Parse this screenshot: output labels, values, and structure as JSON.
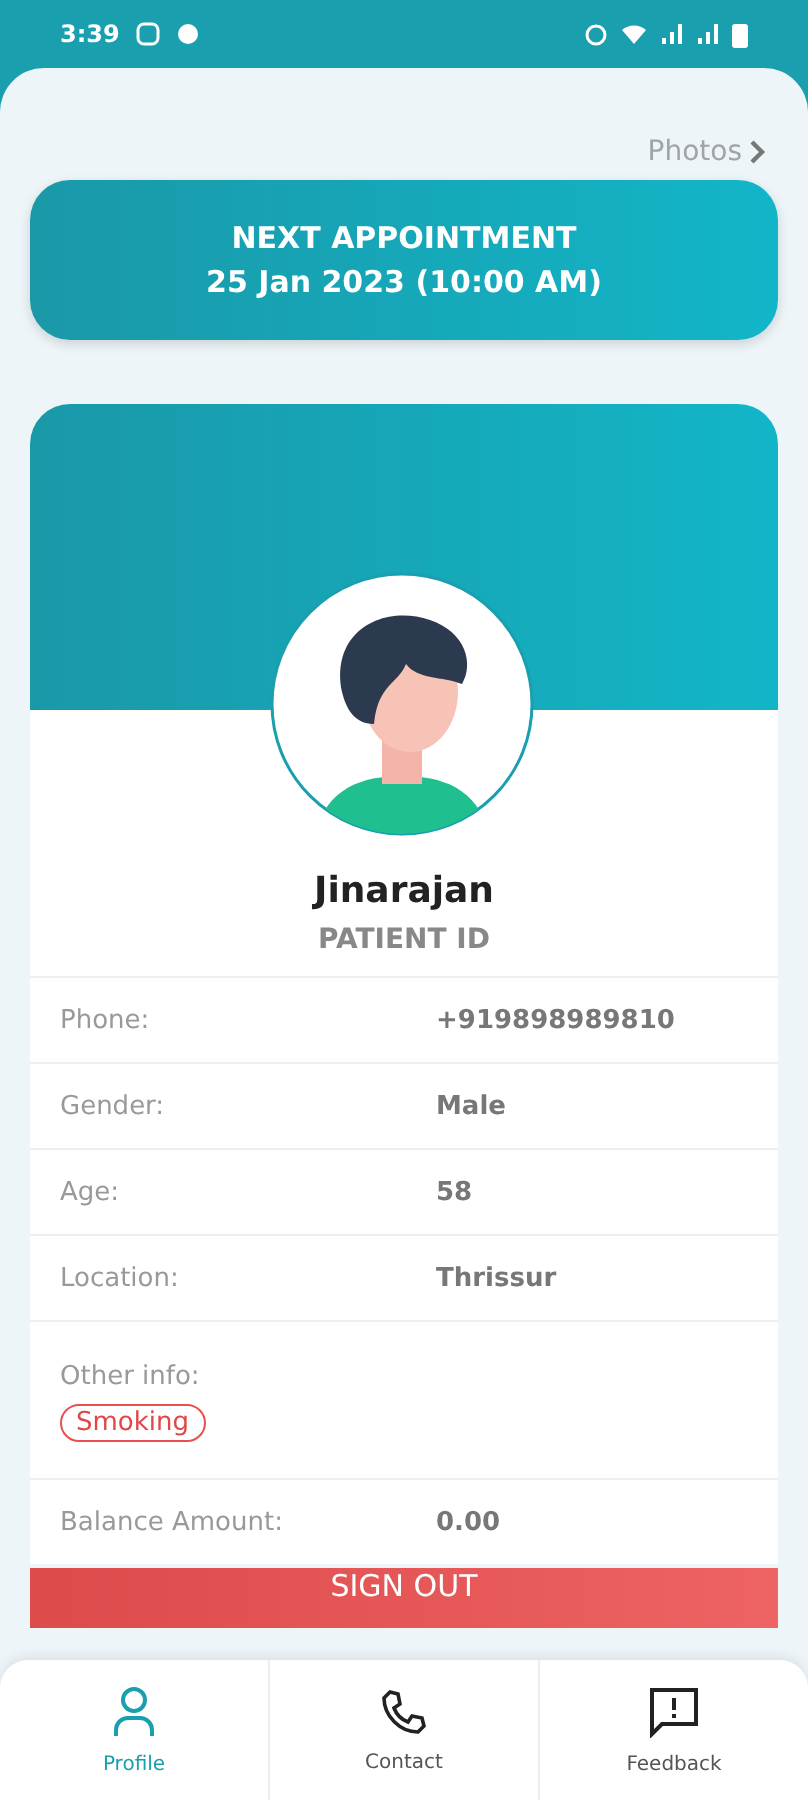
{
  "status_bar": {
    "time": "3:39"
  },
  "photos_link": {
    "label": "Photos"
  },
  "appointment": {
    "title": "NEXT APPOINTMENT",
    "when": "25 Jan 2023 (10:00 AM)"
  },
  "profile": {
    "name": "Jinarajan",
    "patient_id": "PATIENT ID"
  },
  "details": [
    {
      "kind": "text",
      "label": "Phone:",
      "value": "+919898989810"
    },
    {
      "kind": "text",
      "label": "Gender:",
      "value": "Male"
    },
    {
      "kind": "text",
      "label": "Age:",
      "value": "58"
    },
    {
      "kind": "text",
      "label": "Location:",
      "value": "Thrissur"
    },
    {
      "kind": "tags",
      "label": "Other info:",
      "tags": [
        "Smoking"
      ]
    },
    {
      "kind": "text",
      "label": "Balance Amount:",
      "value": "0.00"
    }
  ],
  "sign_out": {
    "label": "SIGN OUT"
  },
  "bottom_nav": [
    {
      "label": "Profile",
      "kind": "person",
      "selected": true
    },
    {
      "label": "Contact",
      "kind": "phone",
      "selected": false
    },
    {
      "label": "Feedback",
      "kind": "feedback",
      "selected": false
    }
  ]
}
